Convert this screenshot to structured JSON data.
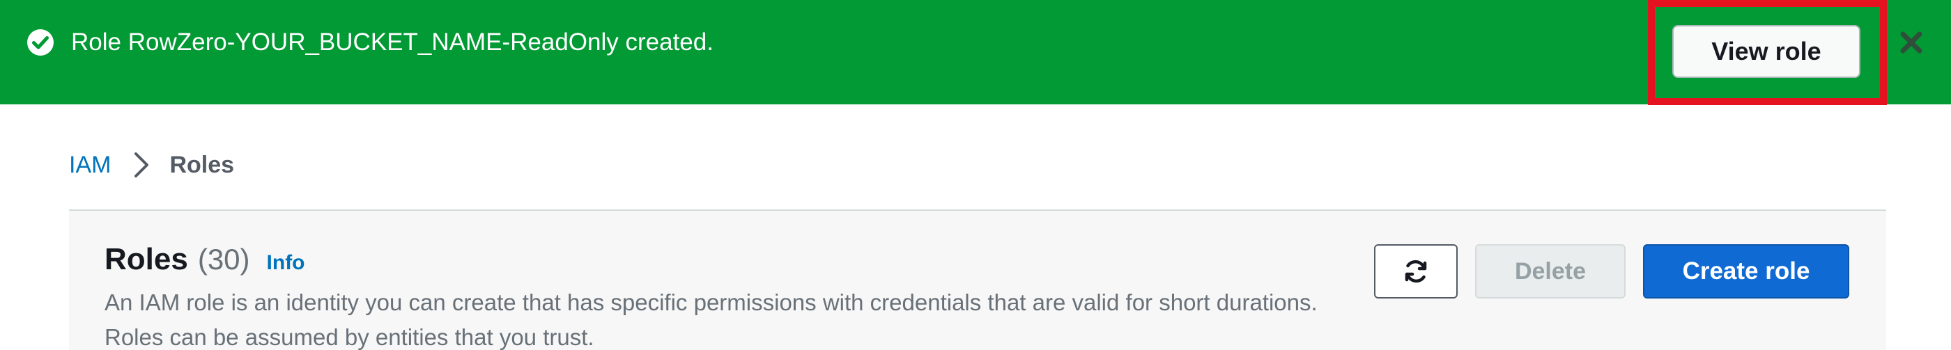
{
  "flash": {
    "icon": "check-circle-icon",
    "message": "Role RowZero-YOUR_BUCKET_NAME-ReadOnly created.",
    "action_label": "View role",
    "close_icon": "close-icon",
    "background_color": "#029a34",
    "highlight_color": "#e5131f"
  },
  "breadcrumb": {
    "items": [
      {
        "label": "IAM",
        "link": true
      },
      {
        "label": "Roles",
        "link": false
      }
    ],
    "separator_icon": "chevron-right-icon"
  },
  "roles_panel": {
    "title": "Roles",
    "count": "(30)",
    "info_label": "Info",
    "description": "An IAM role is an identity you can create that has specific permissions with credentials that are valid for short durations. Roles can be assumed by entities that you trust.",
    "refresh_icon": "refresh-icon",
    "delete_label": "Delete",
    "create_label": "Create role",
    "primary_color": "#0f6bd3"
  }
}
